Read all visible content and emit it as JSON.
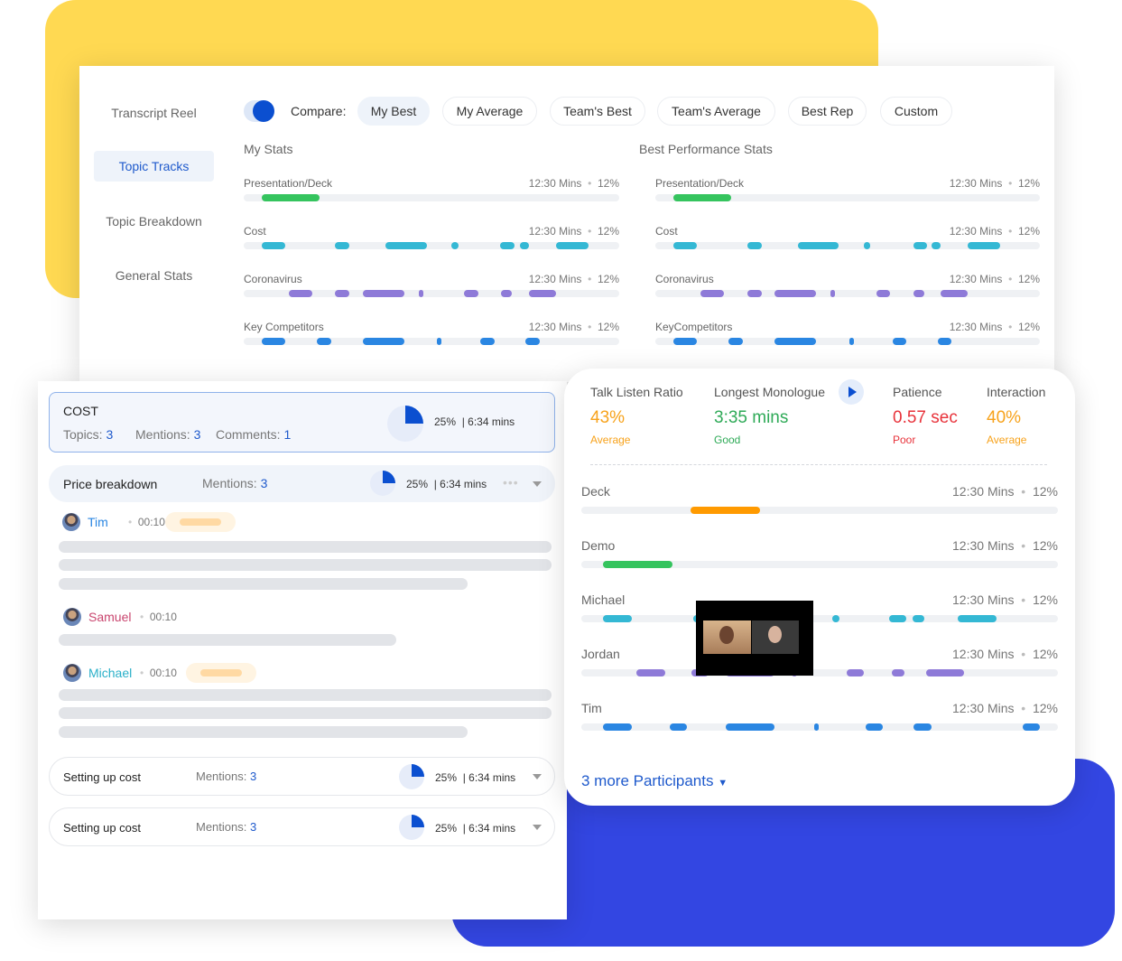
{
  "colors": {
    "yellow": "#FFD952",
    "blue": "#3346E2",
    "accent": "#1F5ACC",
    "green": "#35C45E",
    "cyan": "#34B8D4",
    "purple": "#8E7AD8",
    "blueSeg": "#2A86E2",
    "orange": "#FF9A00",
    "red": "#E8333B"
  },
  "nav": {
    "items": [
      {
        "label": "Transcript Reel"
      },
      {
        "label": "Topic Tracks",
        "active": true
      },
      {
        "label": "Topic Breakdown"
      },
      {
        "label": "General Stats"
      }
    ]
  },
  "compare": {
    "toggle_on": true,
    "label": "Compare:",
    "options": [
      "My Best",
      "My Average",
      "Team's Best",
      "Team's Average",
      "Best Rep",
      "Custom"
    ],
    "selected": "My Best"
  },
  "my_stats": {
    "title": "My Stats",
    "rows": [
      {
        "label": "Presentation/Deck",
        "time": "12:30 Mins",
        "pct": "12%",
        "color": "green",
        "segments": [
          [
            0.048,
            0.202
          ]
        ]
      },
      {
        "label": "Cost",
        "time": "12:30 Mins",
        "pct": "12%",
        "color": "cyan",
        "segments": [
          [
            0.048,
            0.111
          ],
          [
            0.243,
            0.281
          ],
          [
            0.377,
            0.488
          ],
          [
            0.553,
            0.572
          ],
          [
            0.683,
            0.721
          ],
          [
            0.736,
            0.76
          ],
          [
            0.832,
            0.918
          ]
        ]
      },
      {
        "label": "Coronavirus",
        "time": "12:30 Mins",
        "pct": "12%",
        "color": "purple",
        "segments": [
          [
            0.12,
            0.183
          ],
          [
            0.243,
            0.281
          ],
          [
            0.317,
            0.428
          ],
          [
            0.466,
            0.478
          ],
          [
            0.587,
            0.625
          ],
          [
            0.685,
            0.714
          ],
          [
            0.76,
            0.832
          ]
        ]
      },
      {
        "label": "Key Competitors",
        "time": "12:30 Mins",
        "pct": "12%",
        "color": "blueSeg",
        "segments": [
          [
            0.048,
            0.111
          ],
          [
            0.195,
            0.233
          ],
          [
            0.317,
            0.428
          ],
          [
            0.514,
            0.526
          ],
          [
            0.63,
            0.668
          ],
          [
            0.75,
            0.788
          ]
        ]
      }
    ]
  },
  "best_stats": {
    "title": "Best Performance Stats",
    "rows": [
      {
        "label": "Presentation/Deck",
        "time": "12:30 Mins",
        "pct": "12%",
        "color": "green",
        "segments": [
          [
            0.048,
            0.197
          ]
        ]
      },
      {
        "label": "Cost",
        "time": "12:30 Mins",
        "pct": "12%",
        "color": "cyan",
        "segments": [
          [
            0.048,
            0.108
          ],
          [
            0.24,
            0.277
          ],
          [
            0.37,
            0.477
          ],
          [
            0.542,
            0.559
          ],
          [
            0.671,
            0.707
          ],
          [
            0.719,
            0.742
          ],
          [
            0.813,
            0.897
          ]
        ]
      },
      {
        "label": "Coronavirus",
        "time": "12:30 Mins",
        "pct": "12%",
        "color": "purple",
        "segments": [
          [
            0.117,
            0.178
          ],
          [
            0.24,
            0.277
          ],
          [
            0.31,
            0.418
          ],
          [
            0.456,
            0.468
          ],
          [
            0.575,
            0.611
          ],
          [
            0.671,
            0.699
          ],
          [
            0.742,
            0.813
          ]
        ]
      },
      {
        "label": "KeyCompetitors",
        "time": "12:30 Mins",
        "pct": "12%",
        "color": "blueSeg",
        "segments": [
          [
            0.048,
            0.108
          ],
          [
            0.19,
            0.228
          ],
          [
            0.31,
            0.418
          ],
          [
            0.504,
            0.516
          ],
          [
            0.617,
            0.653
          ],
          [
            0.735,
            0.77
          ]
        ]
      }
    ]
  },
  "topic": {
    "title": "COST",
    "topics_label": "Topics:",
    "topics": "3",
    "mentions_label": "Mentions:",
    "mentions": "3",
    "comments_label": "Comments:",
    "comments": "1",
    "pct": "25%",
    "time": "| 6:34 mins"
  },
  "price": {
    "title": "Price breakdown",
    "mentions_label": "Mentions:",
    "mentions": "3",
    "pct": "25%",
    "time": "| 6:34 mins"
  },
  "comments": [
    {
      "name": "Tim",
      "time": "00:10",
      "color": "#2A86E2"
    },
    {
      "name": "Samuel",
      "time": "00:10",
      "color": "#C9466F"
    },
    {
      "name": "Michael",
      "time": "00:10",
      "color": "#2BB0C9"
    }
  ],
  "sub_topics": [
    {
      "title": "Setting up cost",
      "mentions_label": "Mentions:",
      "mentions": "3",
      "pct": "25%",
      "time": "| 6:34 mins"
    },
    {
      "title": "Setting up cost",
      "mentions_label": "Mentions:",
      "mentions": "3",
      "pct": "25%",
      "time": "| 6:34 mins"
    }
  ],
  "metrics": [
    {
      "label": "Talk Listen Ratio",
      "value": "43%",
      "rating": "Average",
      "color": "#F7A21B"
    },
    {
      "label": "Longest Monologue",
      "value": "3:35 mins",
      "rating": "Good",
      "color": "#2EAA57"
    },
    {
      "label": "Patience",
      "value": "0.57 sec",
      "rating": "Poor",
      "color": "#E8333B"
    },
    {
      "label": "Interaction",
      "value": "40%",
      "rating": "Average",
      "color": "#F7A21B"
    }
  ],
  "participants": {
    "rows": [
      {
        "label": "Deck",
        "time": "12:30 Mins",
        "pct": "12%",
        "color": "orange",
        "segments": [
          [
            0.229,
            0.375
          ]
        ]
      },
      {
        "label": "Demo",
        "time": "12:30 Mins",
        "pct": "12%",
        "color": "green",
        "segments": [
          [
            0.045,
            0.191
          ]
        ]
      },
      {
        "label": "Michael",
        "time": "12:30 Mins",
        "pct": "12%",
        "color": "cyan",
        "segments": [
          [
            0.045,
            0.106
          ],
          [
            0.235,
            0.28
          ],
          [
            0.527,
            0.542
          ],
          [
            0.646,
            0.682
          ],
          [
            0.695,
            0.72
          ],
          [
            0.79,
            0.871
          ]
        ]
      },
      {
        "label": "Jordan",
        "time": "12:30 Mins",
        "pct": "12%",
        "color": "purple",
        "segments": [
          [
            0.116,
            0.176
          ],
          [
            0.231,
            0.267
          ],
          [
            0.303,
            0.405
          ],
          [
            0.441,
            0.453
          ],
          [
            0.557,
            0.593
          ],
          [
            0.652,
            0.678
          ],
          [
            0.723,
            0.803
          ]
        ]
      },
      {
        "label": "Tim",
        "time": "12:30 Mins",
        "pct": "12%",
        "color": "blueSeg",
        "segments": [
          [
            0.045,
            0.106
          ],
          [
            0.186,
            0.222
          ],
          [
            0.303,
            0.405
          ],
          [
            0.489,
            0.498
          ],
          [
            0.597,
            0.633
          ],
          [
            0.697,
            0.735
          ],
          [
            0.926,
            0.962
          ]
        ]
      }
    ],
    "more_label": "3 more Participants"
  }
}
